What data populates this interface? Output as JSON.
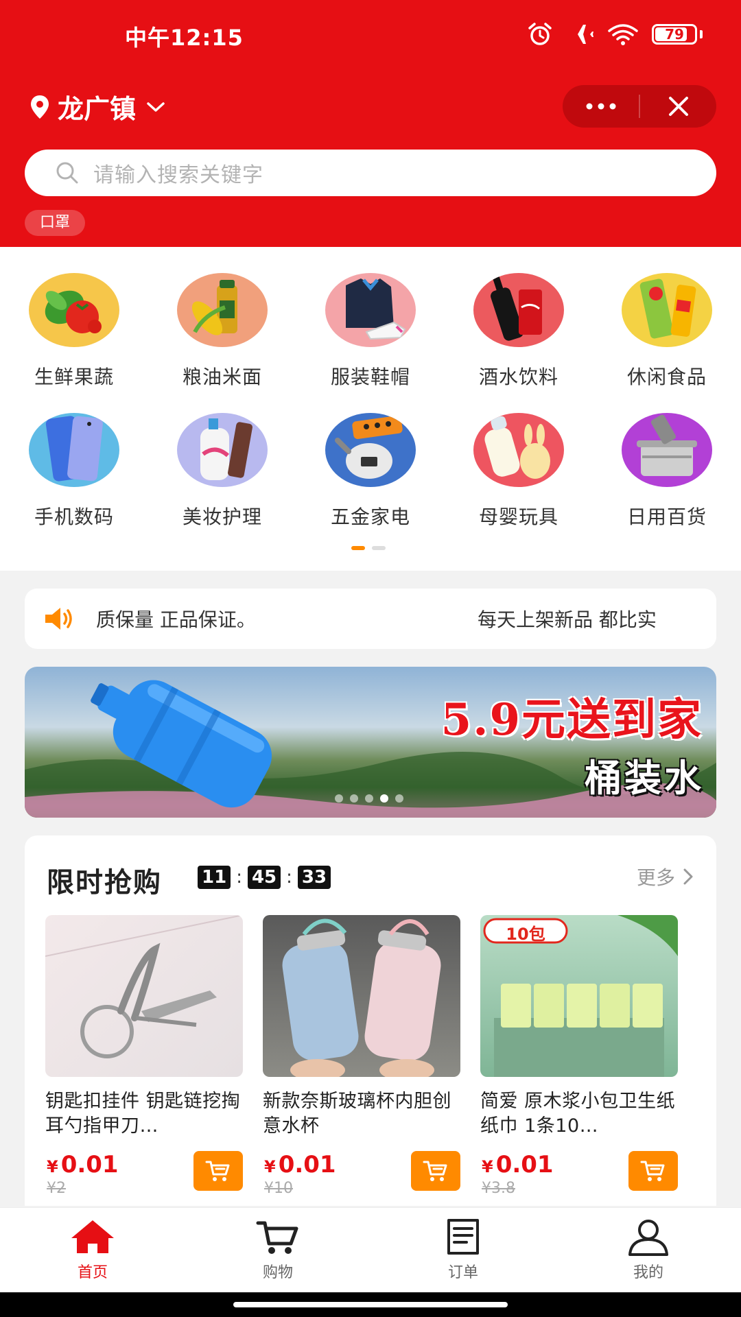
{
  "status_bar": {
    "time": "中午12:15",
    "battery": "79"
  },
  "header": {
    "location": "龙广镇",
    "search_placeholder": "请输入搜索关键字",
    "hot_tag": "口罩"
  },
  "categories": [
    {
      "label": "生鲜果蔬",
      "icon": "vegetables-icon"
    },
    {
      "label": "粮油米面",
      "icon": "grain-oil-icon"
    },
    {
      "label": "服装鞋帽",
      "icon": "clothing-icon"
    },
    {
      "label": "酒水饮料",
      "icon": "drinks-icon"
    },
    {
      "label": "休闲食品",
      "icon": "snacks-icon"
    },
    {
      "label": "手机数码",
      "icon": "phone-icon"
    },
    {
      "label": "美妆护理",
      "icon": "cosmetics-icon"
    },
    {
      "label": "五金家电",
      "icon": "appliance-icon"
    },
    {
      "label": "母婴玩具",
      "icon": "baby-toys-icon"
    },
    {
      "label": "日用百货",
      "icon": "household-icon"
    }
  ],
  "notice": {
    "text1": "质保量 正品保证。",
    "text2": "每天上架新品  都比实"
  },
  "banner": {
    "title": "5.9元送到家",
    "subtitle": "桶装水"
  },
  "flash_sale": {
    "title": "限时抢购",
    "countdown": {
      "hours": "11",
      "minutes": "45",
      "seconds": "33"
    },
    "more": "更多",
    "products": [
      {
        "name": "钥匙扣挂件 钥匙链挖掏耳勺指甲刀…",
        "price": "0.01",
        "currency": "¥",
        "old_price": "¥2"
      },
      {
        "name": "新款奈斯玻璃杯内胆创意水杯",
        "price": "0.01",
        "currency": "¥",
        "old_price": "¥10"
      },
      {
        "name": "简爱 原木浆小包卫生纸  纸巾 1条10…",
        "price": "0.01",
        "currency": "¥",
        "old_price": "¥3.8"
      }
    ],
    "product_badge": "10包"
  },
  "tabs": [
    {
      "label": "首页",
      "active": true
    },
    {
      "label": "购物",
      "active": false
    },
    {
      "label": "订单",
      "active": false
    },
    {
      "label": "我的",
      "active": false
    }
  ],
  "colors": {
    "brand": "#e60f14",
    "accent": "#ff8a00"
  }
}
